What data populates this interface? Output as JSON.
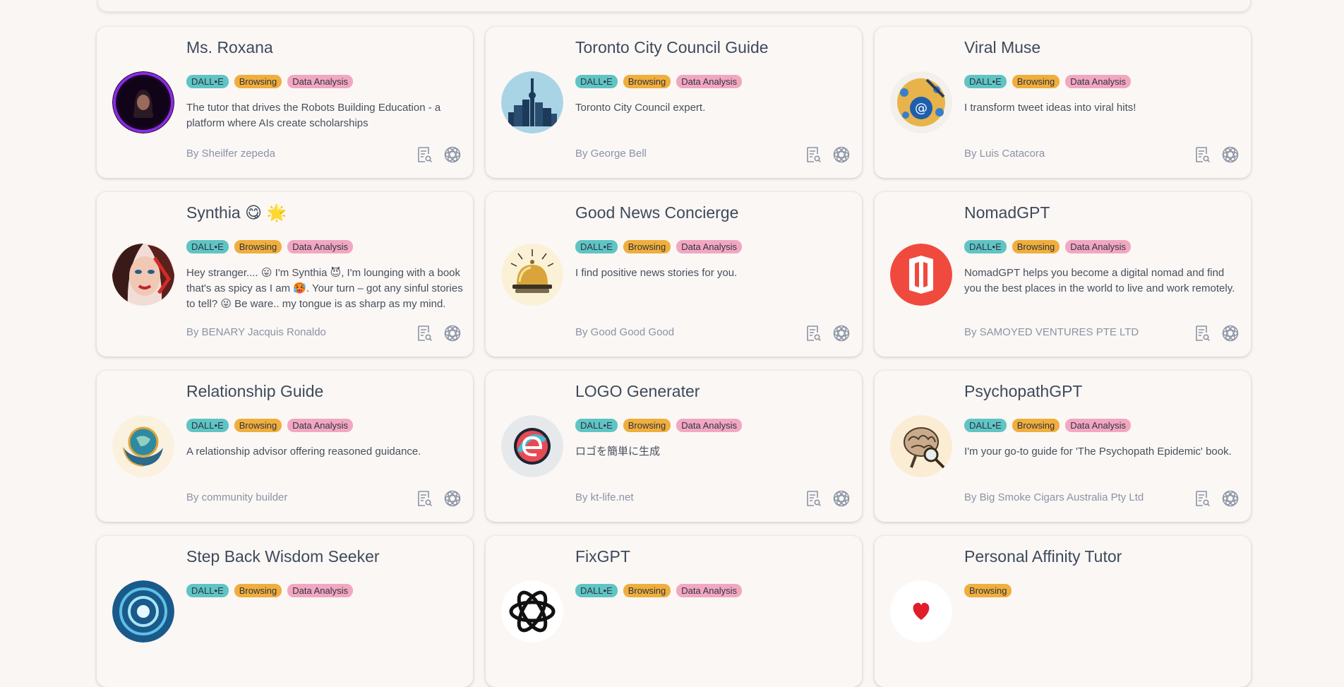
{
  "tags": {
    "dalle": "DALL•E",
    "browsing": "Browsing",
    "data_analysis": "Data Analysis"
  },
  "cards": [
    {
      "title": "Ms. Roxana",
      "desc": "The tutor that drives the Robots Building Education - a platform where AIs create scholarships",
      "author": "By Sheilfer zepeda",
      "avatar_icon": "woman-portrait-icon"
    },
    {
      "title": "Toronto City Council Guide",
      "desc": "Toronto City Council expert.",
      "author": "By George Bell",
      "avatar_icon": "city-skyline-icon"
    },
    {
      "title": "Viral Muse",
      "desc": "I transform tweet ideas into viral hits!",
      "author": "By Luis Catacora",
      "avatar_icon": "social-globe-icon"
    },
    {
      "title": "Synthia 😋 🌟",
      "desc": "Hey stranger.... 😛 I'm Synthia 😈, I'm lounging with a book that's as spicy as I am 🥵. Your turn – got any sinful stories to tell? 😜 Be ware.. my tongue is as sharp as my mind.",
      "author": "By BENARY Jacquis Ronaldo",
      "avatar_icon": "woman-face-icon"
    },
    {
      "title": "Good News Concierge",
      "desc": "I find positive news stories for you.",
      "author": "By Good Good Good",
      "avatar_icon": "concierge-bell-icon"
    },
    {
      "title": "NomadGPT",
      "desc": "NomadGPT helps you become a digital nomad and find you the best places in the world to live and work remotely.",
      "author": "By SAMOYED VENTURES PTE LTD",
      "avatar_icon": "nomad-logo-icon"
    },
    {
      "title": "Relationship Guide",
      "desc": "A relationship advisor offering reasoned guidance.",
      "author": "By community builder",
      "avatar_icon": "hands-globe-icon"
    },
    {
      "title": "LOGO Generater",
      "desc": "ロゴを簡単に生成",
      "author": "By kt-life.net",
      "avatar_icon": "logo-e-icon"
    },
    {
      "title": "PsychopathGPT",
      "desc": "I'm your go-to guide for 'The Psychopath Epidemic' book.",
      "author": "By Big Smoke Cigars Australia Pty Ltd",
      "avatar_icon": "brain-magnifier-icon"
    },
    {
      "title": "Step Back Wisdom Seeker",
      "desc": "",
      "author": "",
      "avatar_icon": "vortex-icon"
    },
    {
      "title": "FixGPT",
      "desc": "",
      "author": "",
      "avatar_icon": "openai-knot-icon"
    },
    {
      "title": "Personal Affinity Tutor",
      "desc": "",
      "author": "",
      "avatar_icon": "heart-icon"
    }
  ],
  "icons": {
    "details": "document-search-icon",
    "chat": "openai-chat-icon"
  },
  "colors": {
    "dalle": "#5fc5c4",
    "browsing": "#f0ae3c",
    "data_analysis": "#f2a7c1",
    "title": "#3d4a5c",
    "author": "#8a93a6"
  }
}
